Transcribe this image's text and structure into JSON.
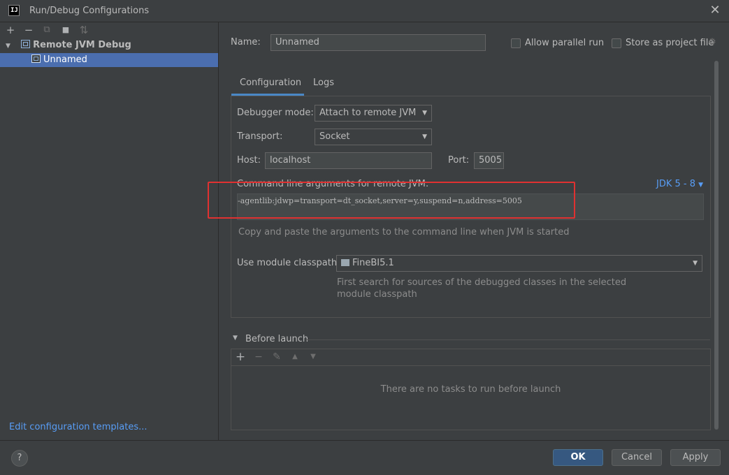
{
  "window": {
    "app_icon_text": "IJ",
    "title": "Run/Debug Configurations",
    "close_glyph": "✕"
  },
  "sidebar": {
    "toolbar": [
      {
        "name": "add-config-button",
        "glyph": "+",
        "icon": "plus-icon"
      },
      {
        "name": "remove-config-button",
        "glyph": "−",
        "icon": "minus-icon"
      },
      {
        "name": "copy-config-button",
        "glyph": "⧉",
        "icon": "copy-icon"
      },
      {
        "name": "move-to-folder-button",
        "glyph": "■",
        "icon": "folder-icon"
      },
      {
        "name": "sort-button",
        "glyph": "⇅",
        "icon": "sort-icon"
      }
    ],
    "tree": {
      "group_label": "Remote JVM Debug",
      "group_arrow": "▼",
      "item_label": "Unnamed"
    },
    "edit_templates_link": "Edit configuration templates..."
  },
  "form": {
    "name_label": "Name:",
    "name_value": "Unnamed",
    "allow_parallel_label": "Allow parallel run",
    "allow_parallel_checked": false,
    "store_project_label": "Store as project file",
    "store_project_checked": false,
    "gear_glyph": "⚙"
  },
  "tabs": [
    {
      "label": "Configuration",
      "active": true
    },
    {
      "label": "Logs",
      "active": false
    }
  ],
  "config": {
    "debugger_mode_label": "Debugger mode:",
    "debugger_mode_value": "Attach to remote JVM",
    "transport_label": "Transport:",
    "transport_value": "Socket",
    "host_label": "Host:",
    "host_value": "localhost",
    "port_label": "Port:",
    "port_value": "5005",
    "cmd_label": "Command line arguments for remote JVM:",
    "jdk_link": "JDK 5 - 8",
    "cmd_value": "-agentlib:jdwp=transport=dt_socket,server=y,suspend=n,address=5005",
    "cmd_hint": "Copy and paste the arguments to the command line when JVM is started",
    "module_label": "Use module classpath:",
    "module_value": "FineBI5.1",
    "module_hint_line1": "First search for sources of the debugged classes in the selected",
    "module_hint_line2": "module classpath"
  },
  "before_launch": {
    "title": "Before launch",
    "arrow": "▼",
    "empty_text": "There are no tasks to run before launch",
    "toolbar": [
      {
        "name": "add-task-button",
        "glyph": "+",
        "icon": "plus-icon"
      },
      {
        "name": "remove-task-button",
        "glyph": "−",
        "icon": "minus-icon"
      },
      {
        "name": "edit-task-button",
        "glyph": "✎",
        "icon": "pencil-icon"
      },
      {
        "name": "move-up-task-button",
        "glyph": "▲",
        "icon": "arrow-up-icon"
      },
      {
        "name": "move-down-task-button",
        "glyph": "▼",
        "icon": "arrow-down-icon"
      }
    ]
  },
  "footer": {
    "help_glyph": "?",
    "ok_label": "OK",
    "cancel_label": "Cancel",
    "apply_label": "Apply"
  },
  "colors": {
    "background": "#3c3f41",
    "selection": "#4b6eaf",
    "link": "#589df6",
    "highlight_box": "#e03131",
    "primary_button": "#365880"
  }
}
